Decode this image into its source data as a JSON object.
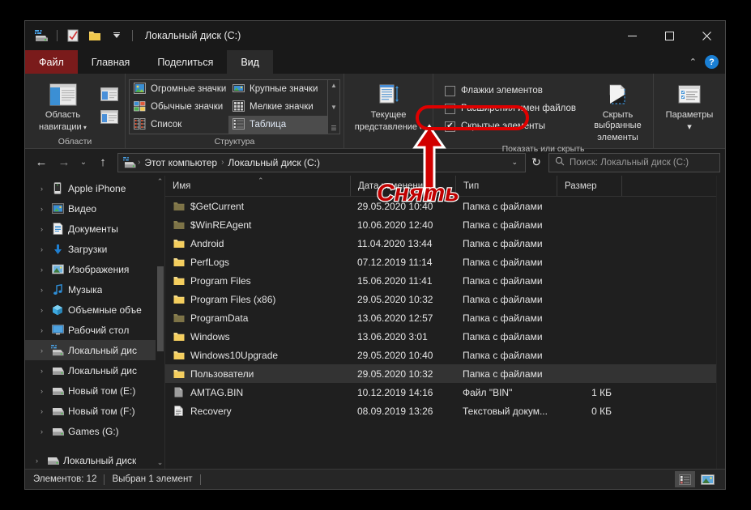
{
  "window": {
    "title": "Локальный диск (C:)",
    "quick_access_icons": [
      "drive-icon",
      "properties-icon",
      "new-folder-icon",
      "customize-chevron-icon"
    ],
    "controls": {
      "minimize": "—",
      "maximize": "□",
      "close": "✕",
      "collapse_ribbon": "⌃",
      "help": "?"
    }
  },
  "tabs": [
    {
      "label": "Файл",
      "kind": "file",
      "active": false
    },
    {
      "label": "Главная",
      "kind": "normal",
      "active": false
    },
    {
      "label": "Поделиться",
      "kind": "normal",
      "active": false
    },
    {
      "label": "Вид",
      "kind": "normal",
      "active": true
    }
  ],
  "ribbon": {
    "groups": [
      {
        "name": "Области",
        "label": "Области",
        "big_button": {
          "label_line1": "Область",
          "label_line2": "навигации",
          "icon": "navigation-pane-icon",
          "has_caret": true
        },
        "side_buttons": [
          "preview-pane-icon",
          "details-pane-icon"
        ]
      },
      {
        "name": "Структура",
        "label": "Структура",
        "gallery": [
          {
            "label": "Огромные значки",
            "icon": "extra-large-icons-icon",
            "selected": false
          },
          {
            "label": "Крупные значки",
            "icon": "large-icons-icon",
            "selected": false
          },
          {
            "label": "Обычные значки",
            "icon": "medium-icons-icon",
            "selected": false
          },
          {
            "label": "Мелкие значки",
            "icon": "small-icons-icon",
            "selected": false
          },
          {
            "label": "Список",
            "icon": "list-view-icon",
            "selected": false
          },
          {
            "label": "Таблица",
            "icon": "details-view-icon",
            "selected": true
          }
        ],
        "scroll_up": "▲",
        "scroll_down": "▼",
        "scroll_more": "☰"
      },
      {
        "name": "Текущее представление",
        "label": "",
        "big_button": {
          "label_line1": "Текущее",
          "label_line2": "представление",
          "icon": "current-view-icon",
          "has_caret": true
        }
      },
      {
        "name": "Показать или скрыть",
        "label": "Показать или скрыть",
        "checkboxes": [
          {
            "label": "Флажки элементов",
            "checked": false
          },
          {
            "label": "Расширения имен файлов",
            "checked": false
          },
          {
            "label": "Скрытые элементы",
            "checked": true,
            "highlighted": true
          }
        ],
        "big_button": {
          "label_line1": "Скрыть выбранные",
          "label_line2": "элементы",
          "icon": "hide-selected-items-icon",
          "has_caret": false
        }
      },
      {
        "name": "Параметры",
        "label": "",
        "big_button": {
          "label_line1": "Параметры",
          "label_line2": "",
          "icon": "options-icon",
          "has_caret": true
        }
      }
    ]
  },
  "addressbar": {
    "back": "←",
    "forward": "→",
    "recent": "⌄",
    "up": "↑",
    "drive_icon": "local-disk-icon",
    "breadcrumbs": [
      "Этот компьютер",
      "Локальный диск (C:)"
    ],
    "separator": "›",
    "dropdown_caret": "⌄",
    "refresh": "↻",
    "search_placeholder": "Поиск: Локальный диск (C:)",
    "search_value": "",
    "search_icon": "search-icon"
  },
  "navpane": {
    "scroll_up": "⌃",
    "scroll_down": "⌄",
    "items": [
      {
        "label": "Apple iPhone",
        "icon": "phone-icon",
        "selected": false
      },
      {
        "label": "Видео",
        "icon": "videos-icon",
        "selected": false
      },
      {
        "label": "Документы",
        "icon": "documents-icon",
        "selected": false
      },
      {
        "label": "Загрузки",
        "icon": "downloads-icon",
        "selected": false
      },
      {
        "label": "Изображения",
        "icon": "pictures-icon",
        "selected": false
      },
      {
        "label": "Музыка",
        "icon": "music-icon",
        "selected": false
      },
      {
        "label": "Объемные объе",
        "icon": "3d-objects-icon",
        "selected": false
      },
      {
        "label": "Рабочий стол",
        "icon": "desktop-icon",
        "selected": false
      },
      {
        "label": "Локальный дис",
        "icon": "local-disk-c-icon",
        "selected": true
      },
      {
        "label": "Локальный дис",
        "icon": "drive-icon",
        "selected": false
      },
      {
        "label": "Новый том (E:)",
        "icon": "drive-icon",
        "selected": false
      },
      {
        "label": "Новый том (F:)",
        "icon": "drive-icon",
        "selected": false
      },
      {
        "label": "Games (G:)",
        "icon": "drive-icon",
        "selected": false
      }
    ],
    "items_after_gap": [
      {
        "label": "Локальный диск",
        "icon": "drive-icon",
        "selected": false
      }
    ],
    "expander": "›"
  },
  "filelist": {
    "columns": [
      {
        "label": "Имя",
        "key": "name",
        "sorted": true
      },
      {
        "label": "Дата изменения",
        "key": "date",
        "sorted": false
      },
      {
        "label": "Тип",
        "key": "type",
        "sorted": false
      },
      {
        "label": "Размер",
        "key": "size",
        "sorted": false
      }
    ],
    "sort_mark": "⌃",
    "rows": [
      {
        "name": "$GetCurrent",
        "date": "29.05.2020 10:40",
        "type": "Папка с файлами",
        "size": "",
        "icon": "folder-dim-icon",
        "selected": false
      },
      {
        "name": "$WinREAgent",
        "date": "10.06.2020 12:40",
        "type": "Папка с файлами",
        "size": "",
        "icon": "folder-dim-icon",
        "selected": false
      },
      {
        "name": "Android",
        "date": "11.04.2020 13:44",
        "type": "Папка с файлами",
        "size": "",
        "icon": "folder-icon",
        "selected": false
      },
      {
        "name": "PerfLogs",
        "date": "07.12.2019 11:14",
        "type": "Папка с файлами",
        "size": "",
        "icon": "folder-icon",
        "selected": false
      },
      {
        "name": "Program Files",
        "date": "15.06.2020 11:41",
        "type": "Папка с файлами",
        "size": "",
        "icon": "folder-icon",
        "selected": false
      },
      {
        "name": "Program Files (x86)",
        "date": "29.05.2020 10:32",
        "type": "Папка с файлами",
        "size": "",
        "icon": "folder-icon",
        "selected": false
      },
      {
        "name": "ProgramData",
        "date": "13.06.2020 12:57",
        "type": "Папка с файлами",
        "size": "",
        "icon": "folder-dim-icon",
        "selected": false
      },
      {
        "name": "Windows",
        "date": "13.06.2020 3:01",
        "type": "Папка с файлами",
        "size": "",
        "icon": "folder-icon",
        "selected": false
      },
      {
        "name": "Windows10Upgrade",
        "date": "29.05.2020 10:40",
        "type": "Папка с файлами",
        "size": "",
        "icon": "folder-icon",
        "selected": false
      },
      {
        "name": "Пользователи",
        "date": "29.05.2020 10:32",
        "type": "Папка с файлами",
        "size": "",
        "icon": "folder-icon",
        "selected": true
      },
      {
        "name": "AMTAG.BIN",
        "date": "10.12.2019 14:16",
        "type": "Файл \"BIN\"",
        "size": "1 КБ",
        "icon": "bin-file-icon",
        "selected": false
      },
      {
        "name": "Recovery",
        "date": "08.09.2019 13:26",
        "type": "Текстовый докум...",
        "size": "0 КБ",
        "icon": "text-file-icon",
        "selected": false
      }
    ]
  },
  "statusbar": {
    "items_count": "Элементов: 12",
    "selection": "Выбран 1 элемент",
    "views": [
      {
        "name": "details-view-button",
        "active": true
      },
      {
        "name": "large-icons-view-button",
        "active": false
      }
    ]
  },
  "annotation": {
    "text": "Снять",
    "color": "#c00000",
    "ring_color": "#e00000",
    "target": "Скрытые элементы"
  }
}
